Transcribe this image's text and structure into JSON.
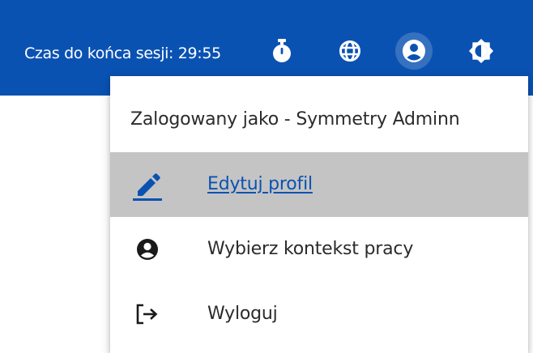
{
  "topbar": {
    "background": "#0a52b2",
    "session_label": "Czas do końca sesji: 29:55",
    "icons": [
      {
        "name": "timer-icon"
      },
      {
        "name": "globe-icon"
      },
      {
        "name": "account-circle-icon",
        "active": true
      },
      {
        "name": "brightness-icon"
      }
    ]
  },
  "dropdown": {
    "header": "Zalogowany jako - Symmetry Adminn",
    "items": [
      {
        "label": "Edytuj profil",
        "icon": "edit-pencil-icon",
        "highlighted": true,
        "link": true
      },
      {
        "label": "Wybierz kontekst pracy",
        "icon": "account-circle-icon"
      },
      {
        "label": "Wyloguj",
        "icon": "logout-icon"
      }
    ]
  },
  "colors": {
    "accent": "#0a52b2",
    "highlight": "#c4c4c4",
    "text": "#2b2b2b"
  }
}
